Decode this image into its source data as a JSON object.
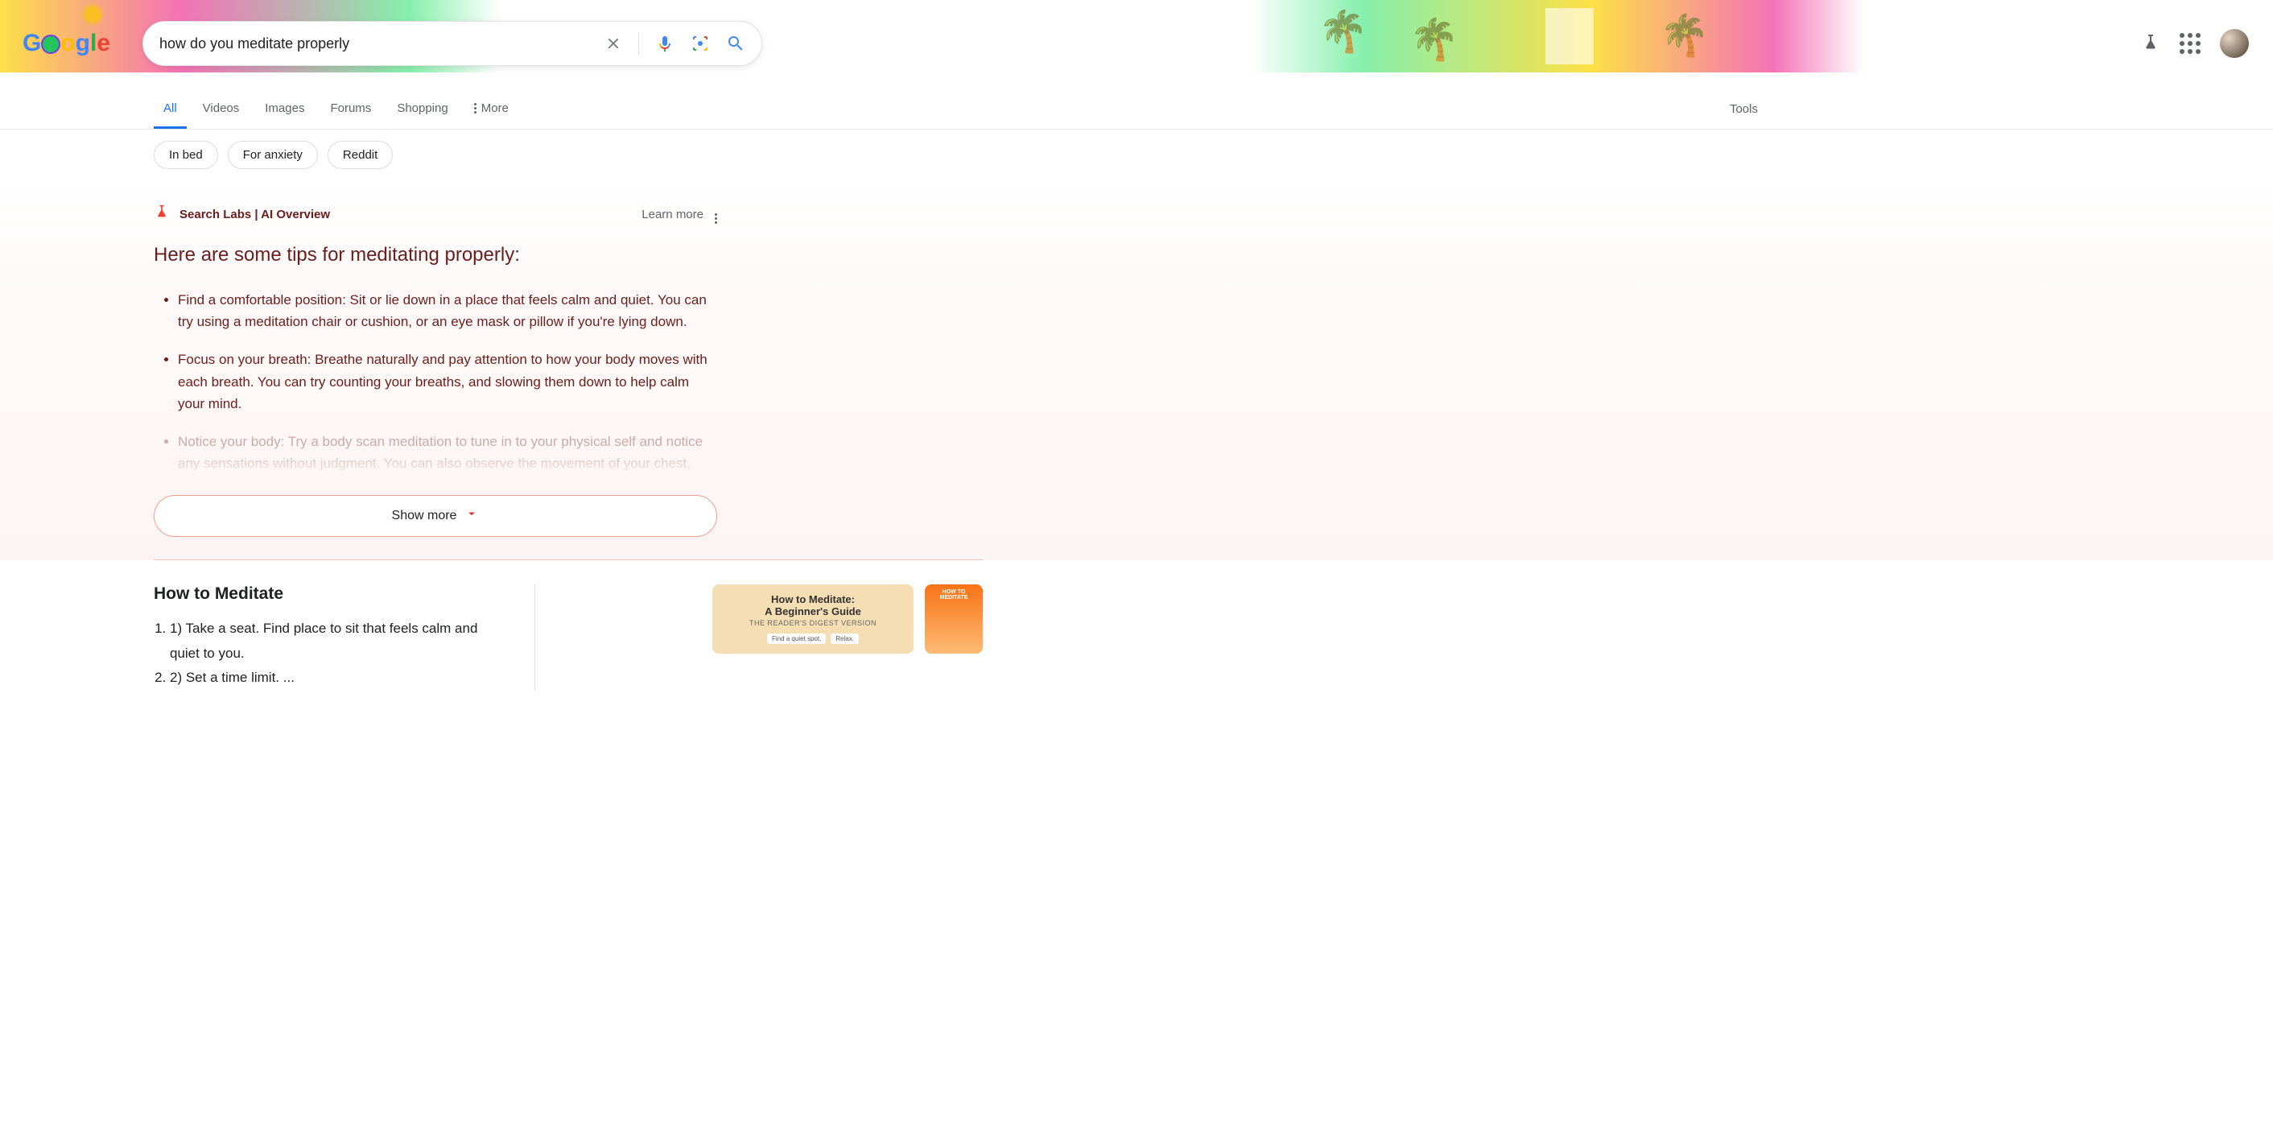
{
  "search": {
    "query": "how do you meditate properly"
  },
  "tabs": {
    "all": "All",
    "videos": "Videos",
    "images": "Images",
    "forums": "Forums",
    "shopping": "Shopping",
    "more": "More",
    "tools": "Tools"
  },
  "chips": [
    "In bed",
    "For anxiety",
    "Reddit"
  ],
  "ai": {
    "label": "Search Labs | AI Overview",
    "learn_more": "Learn more",
    "heading": "Here are some tips for meditating properly:",
    "items": [
      "Find a comfortable position: Sit or lie down in a place that feels calm and quiet. You can try using a meditation chair or cushion, or an eye mask or pillow if you're lying down.",
      "Focus on your breath: Breathe naturally and pay attention to how your body moves with each breath. You can try counting your breaths, and slowing them down to help calm your mind.",
      "Notice your body: Try a body scan meditation to tune in to your physical self and notice any sensations without judgment. You can also observe the movement of your chest, shoulders, rib cage, and belly."
    ],
    "show_more": "Show more"
  },
  "result": {
    "title": "How to Meditate",
    "steps": [
      "1) Take a seat. Find place to sit that feels calm and quiet to you.",
      "2) Set a time limit. ..."
    ]
  },
  "cards": {
    "c1_line1": "How to Meditate:",
    "c1_line2": "A Beginner's Guide",
    "c1_line3": "THE READER'S DIGEST VERSION",
    "c1_btn1": "Find a quiet spot.",
    "c1_btn2": "Relax.",
    "c2_title": "HOW TO MEDITATE"
  }
}
